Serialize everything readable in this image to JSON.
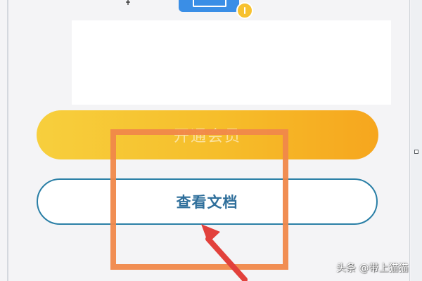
{
  "buttons": {
    "vip_label": "开通会员",
    "docs_label": "查看文档"
  },
  "watermark": {
    "text": "头条 @带上猫猫"
  },
  "icons": {
    "product": "laptop-icon",
    "badge": "coin-icon",
    "cursor": "cursor-icon",
    "callout": "red-arrow-icon"
  },
  "colors": {
    "background": "#f4f4f6",
    "vip_gradient_start": "#f7cf3d",
    "vip_gradient_end": "#f6a61e",
    "docs_border": "#2a7fa6",
    "docs_text": "#2f6f9b",
    "highlight_box": "#f0884a",
    "arrow": "#e2413c"
  }
}
